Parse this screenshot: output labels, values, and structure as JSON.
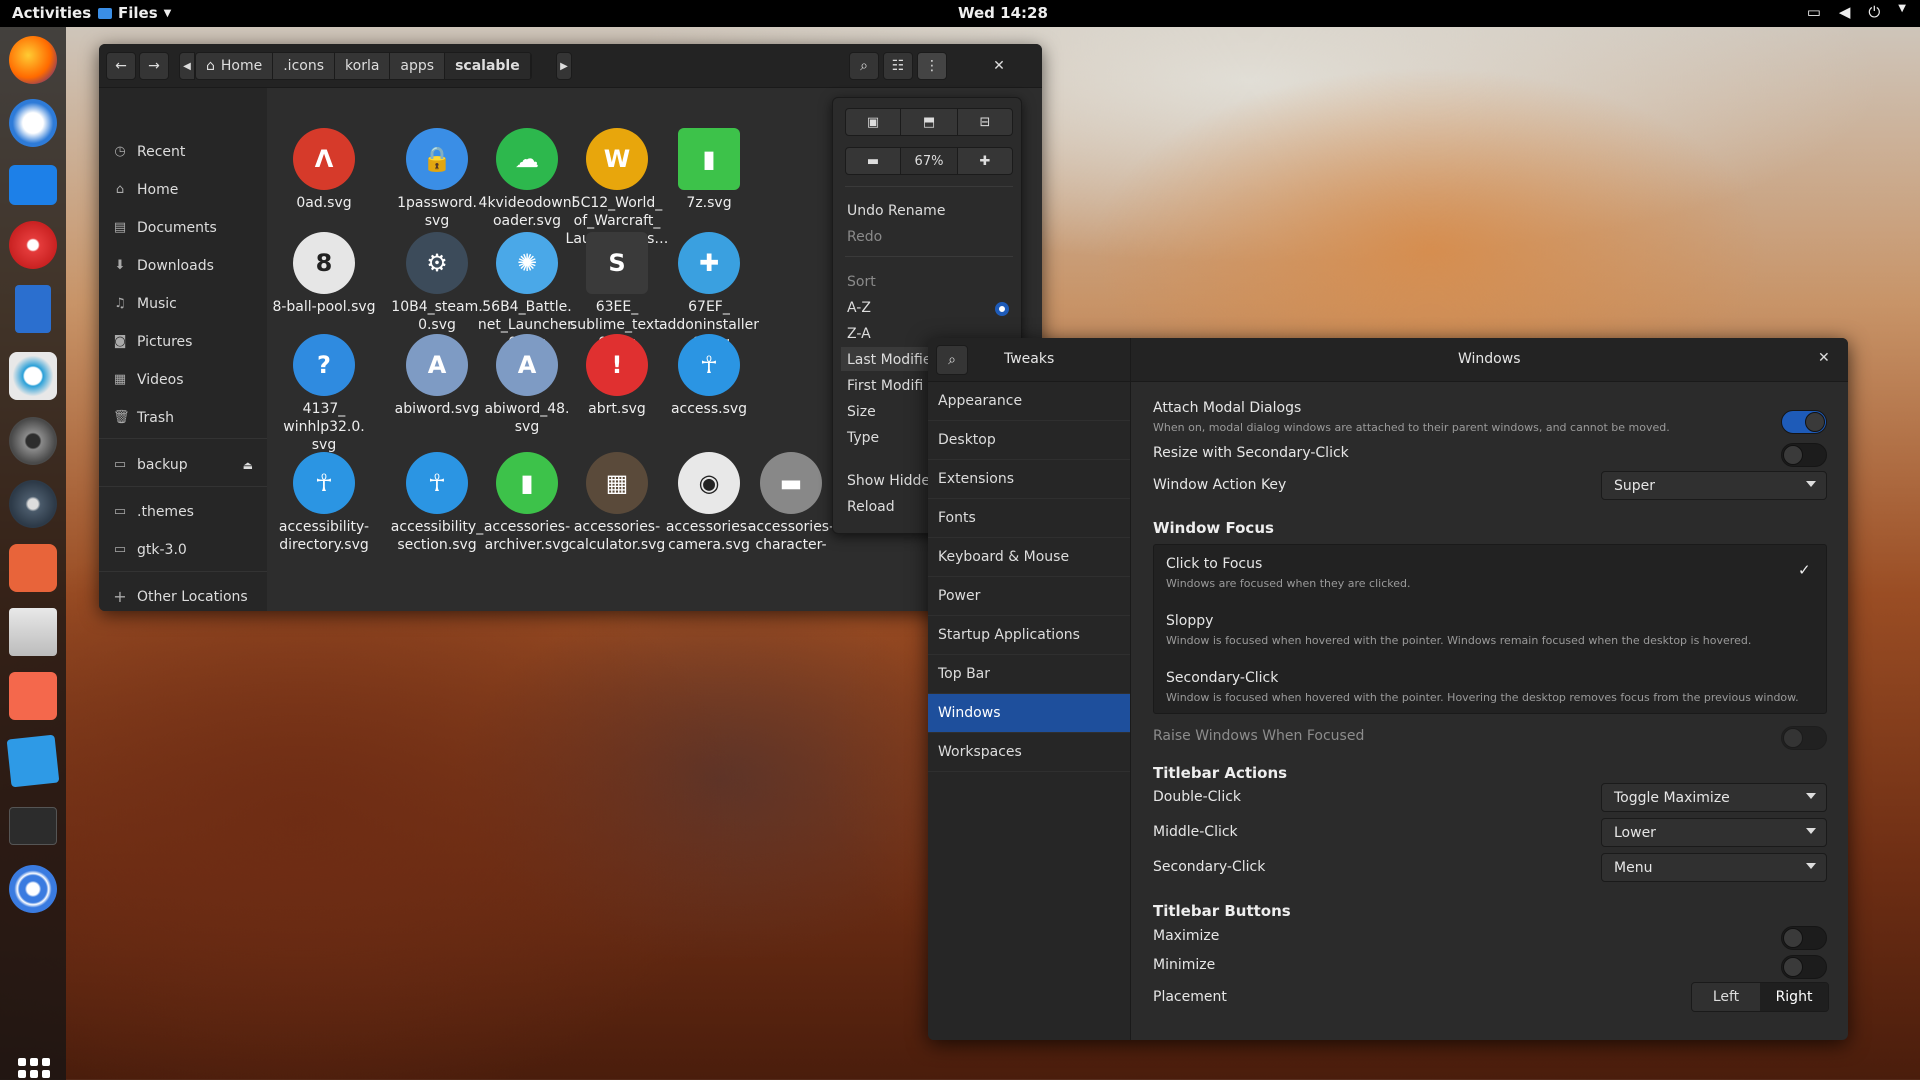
{
  "topbar": {
    "activities": "Activities",
    "app_menu": "Files",
    "clock": "Wed 14:28"
  },
  "files": {
    "breadcrumbs": [
      "Home",
      ".icons",
      "korla",
      "apps",
      "scalable"
    ],
    "sidebar": [
      "Recent",
      "Home",
      "Documents",
      "Downloads",
      "Music",
      "Pictures",
      "Videos",
      "Trash",
      "backup",
      ".themes",
      "gtk-3.0",
      "Other Locations"
    ],
    "items": [
      {
        "name": "0ad.svg",
        "color": "#d63a2a",
        "glyph": "Λ"
      },
      {
        "name": "1password.\nsvg",
        "color": "#3a8ee6",
        "glyph": "🔒"
      },
      {
        "name": "4kvideodownl\noader.svg",
        "color": "#2db84d",
        "glyph": "☁"
      },
      {
        "name": "5C12_World_\nof_Warcraft_\nLauncher.0.s…",
        "color": "#e8a60c",
        "glyph": "W"
      },
      {
        "name": "7z.svg",
        "color": "#3dc24a",
        "glyph": "▮"
      },
      {
        "name": "8-ball-pool.svg",
        "color": "#e6e6e6",
        "glyph": "8"
      },
      {
        "name": "10B4_steam.\n0.svg",
        "color": "#3c4b5a",
        "glyph": "⚙"
      },
      {
        "name": "56B4_Battle.\nnet_Launcher.\n0.svg",
        "color": "#4aa8e8",
        "glyph": "✺"
      },
      {
        "name": "63EE_\nsublime_text.\n0.svg",
        "color": "#3a3a3a",
        "glyph": "S"
      },
      {
        "name": "67EF_\naddoninstaller\n.0.svg",
        "color": "#3aa0e0",
        "glyph": "✚"
      },
      {
        "name": "4137_\nwinhlp32.0.\nsvg",
        "color": "#2f8be0",
        "glyph": "?"
      },
      {
        "name": "abiword.svg",
        "color": "#7e9bc4",
        "glyph": "A"
      },
      {
        "name": "abiword_48.\nsvg",
        "color": "#7e9bc4",
        "glyph": "A"
      },
      {
        "name": "abrt.svg",
        "color": "#e03030",
        "glyph": "!"
      },
      {
        "name": "access.svg",
        "color": "#2b95e3",
        "glyph": "☥"
      },
      {
        "name": "accessibility-\ndirectory.svg",
        "color": "#2b95e3",
        "glyph": "☥"
      },
      {
        "name": "accessibility_\nsection.svg",
        "color": "#2b95e3",
        "glyph": "☥"
      },
      {
        "name": "accessories-\narchiver.svg",
        "color": "#3dc24a",
        "glyph": "▮"
      },
      {
        "name": "accessories-\ncalculator.svg",
        "color": "#5a4a3a",
        "glyph": "▦"
      },
      {
        "name": "accessories-\ncamera.svg",
        "color": "#e8e8e8",
        "glyph": "◉"
      },
      {
        "name": "accessories-\ncharacter-",
        "color": "#888888",
        "glyph": "▬"
      }
    ]
  },
  "popover": {
    "zoom": "67%",
    "undo": "Undo Rename",
    "redo": "Redo",
    "sort": "Sort",
    "az": "A-Z",
    "za": "Z-A",
    "last_modified": "Last Modifie",
    "first_modified": "First Modifi",
    "size": "Size",
    "type": "Type",
    "show_hidden": "Show Hidde",
    "reload": "Reload"
  },
  "tweaks": {
    "title": "Tweaks",
    "section_title": "Windows",
    "sidebar": [
      "Appearance",
      "Desktop",
      "Extensions",
      "Fonts",
      "Keyboard & Mouse",
      "Power",
      "Startup Applications",
      "Top Bar",
      "Windows",
      "Workspaces"
    ],
    "attach_modal": "Attach Modal Dialogs",
    "attach_modal_desc": "When on, modal dialog windows are attached to their parent windows, and cannot be moved.",
    "resize_secondary": "Resize with Secondary-Click",
    "window_action_key": "Window Action Key",
    "window_action_key_value": "Super",
    "window_focus": "Window Focus",
    "focus_options": [
      {
        "title": "Click to Focus",
        "desc": "Windows are focused when they are clicked."
      },
      {
        "title": "Sloppy",
        "desc": "Window is focused when hovered with the pointer. Windows remain focused when the desktop is hovered."
      },
      {
        "title": "Secondary-Click",
        "desc": "Window is focused when hovered with the pointer. Hovering the desktop removes focus from the previous window."
      }
    ],
    "raise_windows": "Raise Windows When Focused",
    "titlebar_actions": "Titlebar Actions",
    "double_click": "Double-Click",
    "double_click_value": "Toggle Maximize",
    "middle_click": "Middle-Click",
    "middle_click_value": "Lower",
    "secondary_click": "Secondary-Click",
    "secondary_click_value": "Menu",
    "titlebar_buttons": "Titlebar Buttons",
    "maximize": "Maximize",
    "minimize": "Minimize",
    "placement": "Placement",
    "left": "Left",
    "right": "Right",
    "accent": "#1e5bb8"
  }
}
